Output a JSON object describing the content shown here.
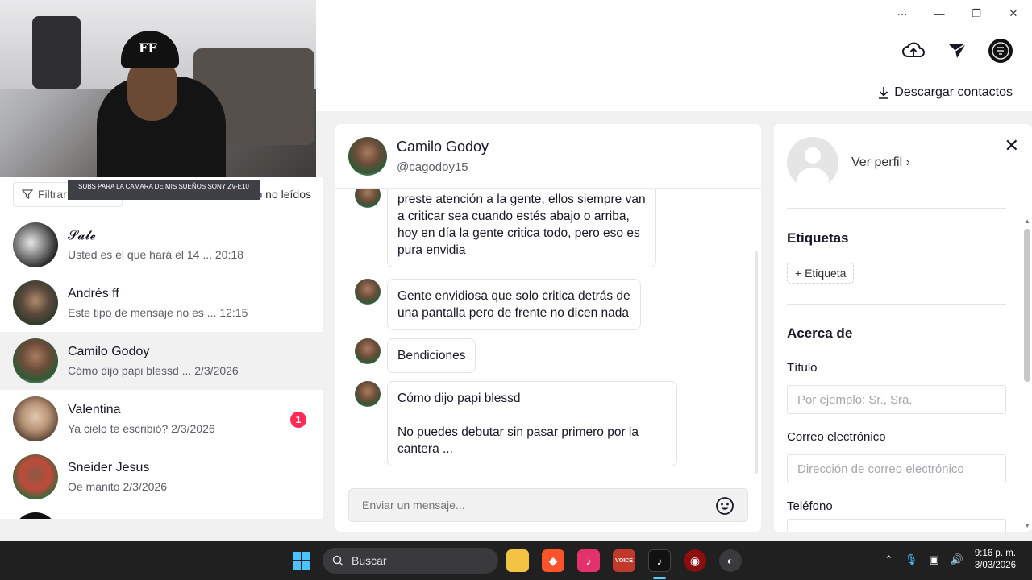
{
  "window": {
    "controls": {
      "more": "···",
      "minimize": "—",
      "restore": "❐",
      "close": "✕"
    },
    "download_contacts": "Descargar contactos"
  },
  "overlay": {
    "banner": "SUBS PARA LA CAMARA DE MIS SUEÑOS SONY ZV-E10",
    "cap_logo": "FF"
  },
  "left": {
    "filter_label": "Filtrar",
    "unread_only": "Solo no leídos",
    "conversations": [
      {
        "name": "𝓢𝓪𝓵𝓮",
        "preview": "Usted es el que hará el 14 ...",
        "time": "20:18",
        "badge": ""
      },
      {
        "name": "Andrés ff",
        "preview": "Este tipo de mensaje no es ...",
        "time": "12:15",
        "badge": ""
      },
      {
        "name": "Camilo Godoy",
        "preview": "Cómo dijo papi blessd ...",
        "time": "2/3/2026",
        "badge": ""
      },
      {
        "name": "Valentina",
        "preview": "Ya cielo te escribió?",
        "time": "2/3/2026",
        "badge": "1"
      },
      {
        "name": "Sneider Jesus",
        "preview": "Oe manito",
        "time": "2/3/2026",
        "badge": ""
      }
    ]
  },
  "chat": {
    "name": "Camilo Godoy",
    "handle": "@cagodoy15",
    "messages": [
      {
        "text": "preste atención a la gente, ellos siempre van\na criticar sea cuando estés abajo o arriba,\nhoy en día la gente critica todo, pero eso es\npura envidia"
      },
      {
        "text": "Gente envidiosa que solo critica detrás de\nuna pantalla pero de frente no dicen nada"
      },
      {
        "text": "Bendiciones"
      },
      {
        "text": "Cómo dijo papi blessd\n\nNo puedes debutar sin pasar primero por la\ncantera ..."
      }
    ],
    "compose_placeholder": "Enviar un mensaje..."
  },
  "profile": {
    "view_profile": "Ver perfil ›",
    "tags_title": "Etiquetas",
    "add_tag": "+ Etiqueta",
    "about_title": "Acerca de",
    "title_label": "Título",
    "title_placeholder": "Por ejemplo: Sr., Sra.",
    "email_label": "Correo electrónico",
    "email_placeholder": "Dirección de correo electrónico",
    "phone_label": "Teléfono"
  },
  "taskbar": {
    "search_label": "Buscar",
    "time": "9:16 p. m.",
    "date": "3/03/2026"
  },
  "colors": {
    "accent": "#fe2c55",
    "taskbar": "#202021"
  }
}
